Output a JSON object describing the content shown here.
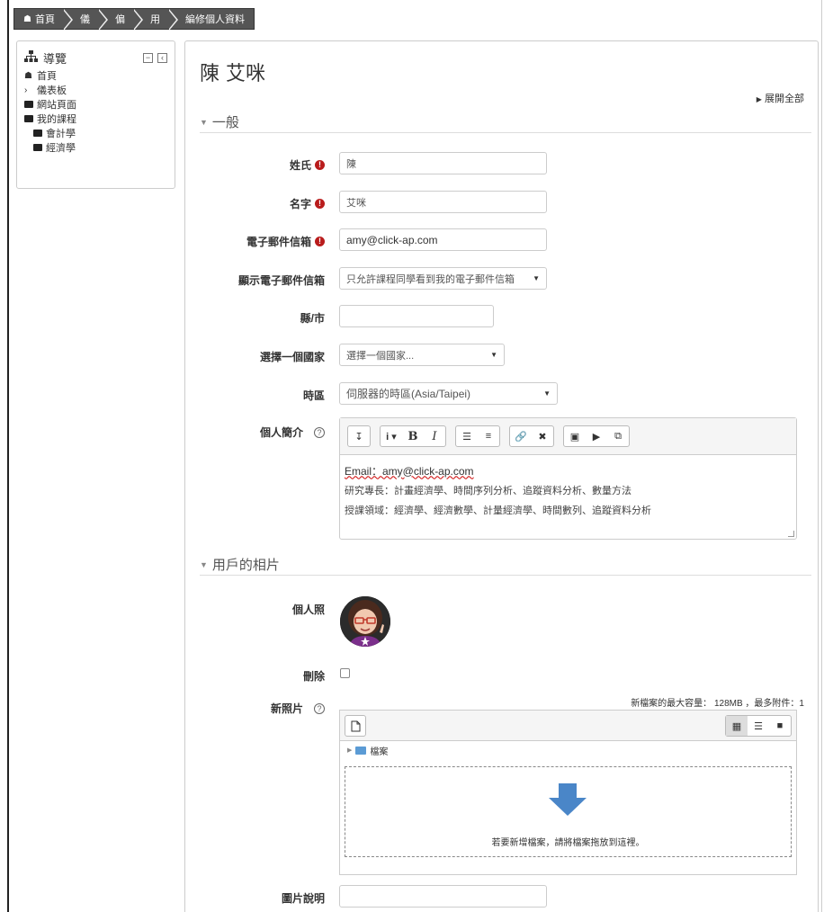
{
  "breadcrumb": [
    "首頁",
    "儀",
    "偏",
    "用",
    "編修個人資料"
  ],
  "nav": {
    "title": "導覽",
    "items": [
      {
        "label": "首頁",
        "icon": "home-icon"
      },
      {
        "label": "儀表板",
        "icon": "chevron-right-icon"
      },
      {
        "label": "網站頁面",
        "icon": "folder-icon"
      },
      {
        "label": "我的課程",
        "icon": "folder-open-icon"
      },
      {
        "label": "會計學",
        "icon": "folder-icon"
      },
      {
        "label": "經濟學",
        "icon": "folder-icon"
      }
    ]
  },
  "page": {
    "title": "陳 艾咪",
    "expand_all": "展開全部"
  },
  "sections": {
    "general": "一般",
    "picture": "用戶的相片"
  },
  "form": {
    "surname_label": "姓氏",
    "surname_value": "陳",
    "firstname_label": "名字",
    "firstname_value": "艾咪",
    "email_label": "電子郵件信箱",
    "email_value": "amy@click-ap.com",
    "display_email_label": "顯示電子郵件信箱",
    "display_email_value": "只允許課程同學看到我的電子郵件信箱",
    "city_label": "縣/市",
    "city_value": "",
    "country_label": "選擇一個國家",
    "country_value": "選擇一個國家...",
    "timezone_label": "時區",
    "timezone_value": "伺服器的時區(Asia/Taipei)",
    "description_label": "個人簡介",
    "description_lines": [
      "Email：amy@click-ap.com",
      "研究專長：計畫經濟學、時間序列分析、追蹤資料分析、數量方法",
      "授課領域：經濟學、經濟數學、計量經濟學、時間數列、追蹤資料分析"
    ],
    "current_picture_label": "個人照",
    "delete_label": "刪除",
    "new_picture_label": "新照片",
    "max_info": "新檔案的最大容量： 128MB ，最多附件：1",
    "files_folder": "檔案",
    "drop_text": "若要新增檔案，請將檔案拖放到這裡。",
    "picture_desc_label": "圖片說明",
    "picture_desc_value": ""
  },
  "colors": {
    "breadcrumb_bg": "#555555",
    "required": "#b91c1c",
    "drop_arrow": "#4a86c8"
  }
}
